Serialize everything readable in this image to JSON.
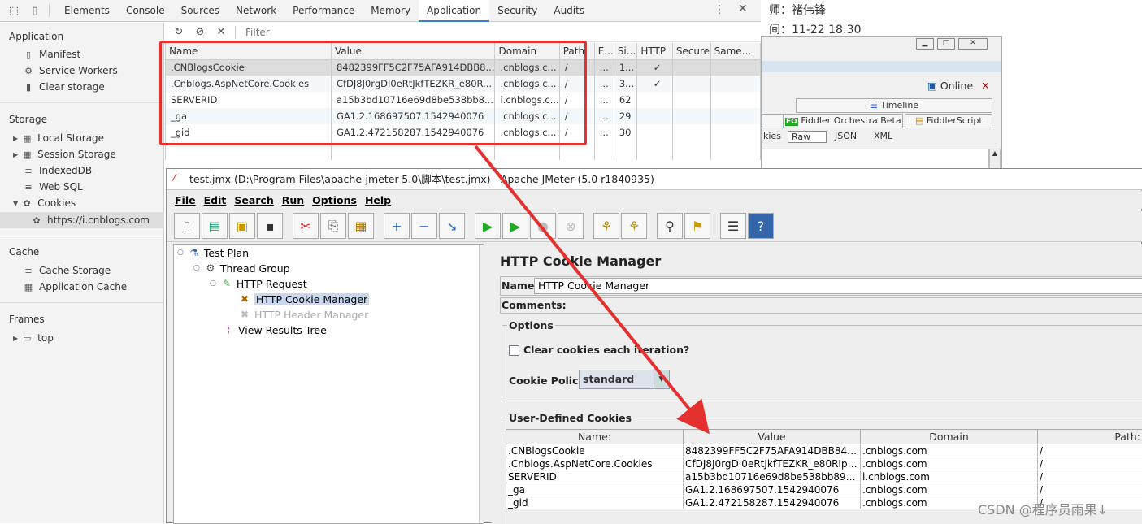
{
  "devtools": {
    "tabs": [
      "Elements",
      "Console",
      "Sources",
      "Network",
      "Performance",
      "Memory",
      "Application",
      "Security",
      "Audits"
    ],
    "active_tab": "Application",
    "sidebar": {
      "application_header": "Application",
      "application_items": [
        "Manifest",
        "Service Workers",
        "Clear storage"
      ],
      "storage_header": "Storage",
      "storage_items": [
        "Local Storage",
        "Session Storage",
        "IndexedDB",
        "Web SQL",
        "Cookies"
      ],
      "cookie_origin": "https://i.cnblogs.com",
      "cache_header": "Cache",
      "cache_items": [
        "Cache Storage",
        "Application Cache"
      ],
      "frames_header": "Frames",
      "frames_items": [
        "top"
      ]
    },
    "filter_placeholder": "Filter",
    "cookie_columns": [
      "Name",
      "Value",
      "Domain",
      "Path",
      "E...",
      "Si...",
      "HTTP",
      "Secure",
      "Same..."
    ],
    "cookies": [
      {
        "name": ".CNBlogsCookie",
        "value": "8482399FF5C2F75AFA914DBB8...",
        "domain": ".cnblogs.c...",
        "path": "/",
        "expires": "...",
        "size": "1...",
        "http": "✓"
      },
      {
        "name": ".Cnblogs.AspNetCore.Cookies",
        "value": "CfDJ8J0rgDI0eRtJkfTEZKR_e80R...",
        "domain": ".cnblogs.c...",
        "path": "/",
        "expires": "...",
        "size": "3...",
        "http": "✓"
      },
      {
        "name": "SERVERID",
        "value": "a15b3bd10716e69d8be538bb8...",
        "domain": "i.cnblogs.c...",
        "path": "/",
        "expires": "...",
        "size": "62",
        "http": ""
      },
      {
        "name": "_ga",
        "value": "GA1.2.168697507.1542940076",
        "domain": ".cnblogs.c...",
        "path": "/",
        "expires": "...",
        "size": "29",
        "http": ""
      },
      {
        "name": "_gid",
        "value": "GA1.2.472158287.1542940076",
        "domain": ".cnblogs.c...",
        "path": "/",
        "expires": "...",
        "size": "30",
        "http": ""
      }
    ]
  },
  "background": {
    "line1": "师：褚伟锋",
    "line2": "间：11-22 18:30"
  },
  "fiddler": {
    "online_label": "Online",
    "timeline_tab": "Timeline",
    "orchestra_tab": "Fiddler Orchestra Beta",
    "script_tab": "FiddlerScript",
    "sub_tabs": [
      "kies",
      "Raw",
      "JSON",
      "XML"
    ]
  },
  "jmeter": {
    "title": "test.jmx (D:\\Program Files\\apache-jmeter-5.0\\脚本\\test.jmx) - Apache JMeter (5.0 r1840935)",
    "menu": [
      "File",
      "Edit",
      "Search",
      "Run",
      "Options",
      "Help"
    ],
    "tree": [
      "Test Plan",
      "Thread Group",
      "HTTP Request",
      "HTTP Cookie Manager",
      "HTTP Header Manager",
      "View Results Tree"
    ],
    "panel_title": "HTTP Cookie Manager",
    "name_label": "Name:",
    "name_value": "HTTP Cookie Manager",
    "comments_label": "Comments:",
    "options_title": "Options",
    "clear_label": "Clear cookies each iteration?",
    "policy_label": "Cookie Policy:",
    "policy_value": "standard",
    "udc_title": "User-Defined Cookies",
    "udc_columns": [
      "Name:",
      "Value",
      "Domain",
      "Path:"
    ],
    "udc_rows": [
      {
        "name": ".CNBlogsCookie",
        "value": "8482399FF5C2F75AFA914DBB842B...",
        "domain": ".cnblogs.com",
        "path": "/"
      },
      {
        "name": ".Cnblogs.AspNetCore.Cookies",
        "value": "CfDJ8J0rgDI0eRtJkfTEZKR_e80RIp5...",
        "domain": ".cnblogs.com",
        "path": "/"
      },
      {
        "name": "SERVERID",
        "value": "a15b3bd10716e69d8be538bb89e87...",
        "domain": "i.cnblogs.com",
        "path": "/"
      },
      {
        "name": "_ga",
        "value": "GA1.2.168697507.1542940076",
        "domain": ".cnblogs.com",
        "path": "/"
      },
      {
        "name": "_gid",
        "value": "GA1.2.472158287.1542940076",
        "domain": ".cnblogs.com",
        "path": "/"
      }
    ]
  },
  "watermark": "CSDN @程序员雨果↓",
  "colors": {
    "annotation_red": "#e53030",
    "devtools_accent": "#3879d9"
  }
}
